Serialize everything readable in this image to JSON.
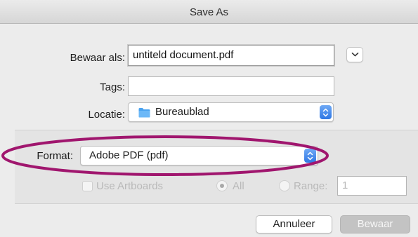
{
  "window": {
    "title": "Save As"
  },
  "form": {
    "save_as_label": "Bewaar als:",
    "save_as_value": "untiteld document.pdf",
    "tags_label": "Tags:",
    "tags_value": "",
    "location_label": "Locatie:",
    "location_value": "Bureaublad"
  },
  "format": {
    "label": "Format:",
    "value": "Adobe PDF (pdf)",
    "use_artboards_label": "Use Artboards",
    "all_label": "All",
    "range_label": "Range:",
    "range_value": "1"
  },
  "buttons": {
    "cancel_label": "Annuleer",
    "save_label": "Bewaar"
  },
  "colors": {
    "highlight_ellipse": "#a0166e",
    "stepper_blue": "#2f77e4",
    "folder_blue": "#4aa3f0"
  },
  "icons": [
    "chevron-down-icon",
    "folder-icon",
    "up-down-stepper-icon"
  ]
}
